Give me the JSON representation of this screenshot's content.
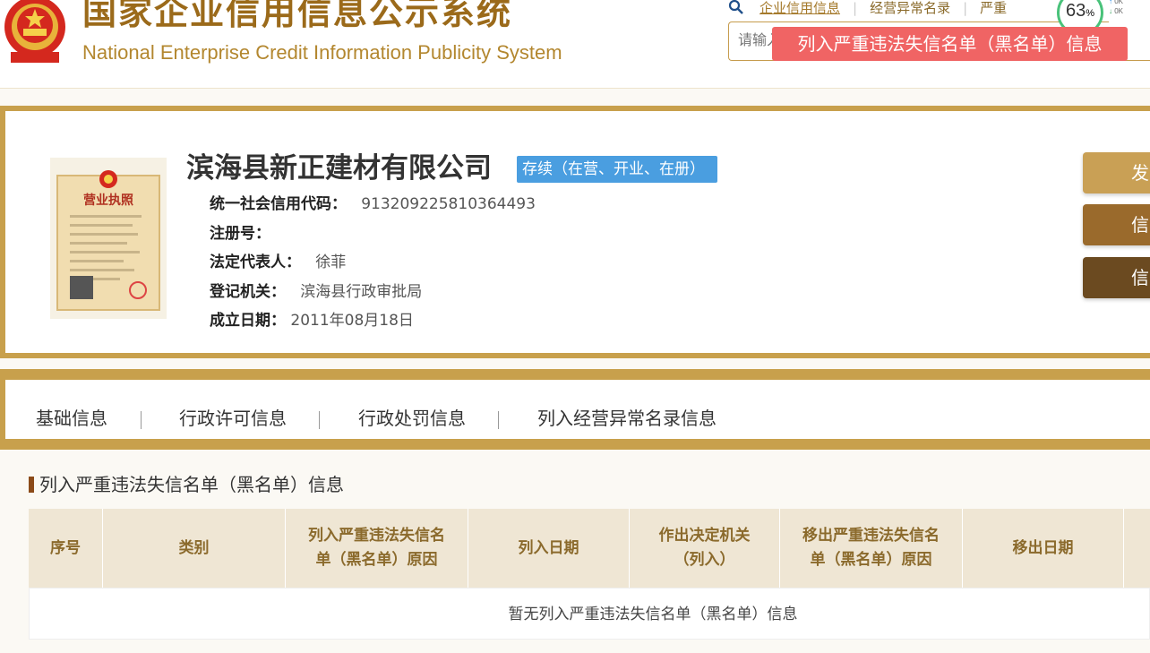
{
  "header": {
    "title_cn": "国家企业信用信息公示系统",
    "title_en": "National Enterprise Credit Information Publicity System",
    "links": [
      "企业信用信息",
      "经营异常名录",
      "严重"
    ],
    "search_placeholder": "请输入企业名称、统一社会信用代码或注册号",
    "overlay_percent": "63",
    "overlay_percent_unit": "%",
    "net_speed_up": "0K",
    "net_speed_down": "0K"
  },
  "company": {
    "name": "滨海县新正建材有限公司",
    "status": "存续（在营、开业、在册）",
    "license_image_title": "营业执照",
    "fields": [
      {
        "label": "统一社会信用代码：",
        "value": "913209225810364493"
      },
      {
        "label": "注册号：",
        "value": ""
      },
      {
        "label": "法定代表人：",
        "value": "徐菲"
      },
      {
        "label": "登记机关：",
        "value": "滨海县行政审批局"
      },
      {
        "label": "成立日期：",
        "value": "2011年08月18日"
      }
    ],
    "side_buttons": [
      "发",
      "信",
      "信"
    ]
  },
  "tabs": [
    {
      "label": "基础信息"
    },
    {
      "label": "行政许可信息"
    },
    {
      "label": "行政处罚信息"
    },
    {
      "label": "列入经营异常名录信息"
    },
    {
      "label": "列入严重违法失信名单（黑名单）信息",
      "active": true
    }
  ],
  "section": {
    "title": "列入严重违法失信名单（黑名单）信息",
    "columns": [
      "序号",
      "类别",
      "列入严重违法失信名单（黑名单）原因",
      "列入日期",
      "作出决定机关（列入）",
      "移出严重违法失信名单（黑名单）原因",
      "移出日期"
    ],
    "empty_message": "暂无列入严重违法失信名单（黑名单）信息"
  },
  "colors": {
    "gold": "#c8a04c",
    "brown_title": "#9b6a1a",
    "status_blue": "#4a9ee0",
    "active_tab": "#f06464",
    "table_header": "#efe6d4",
    "btn1": "#c9a055",
    "btn2": "#9a6a2c",
    "btn3": "#6b4a20"
  }
}
